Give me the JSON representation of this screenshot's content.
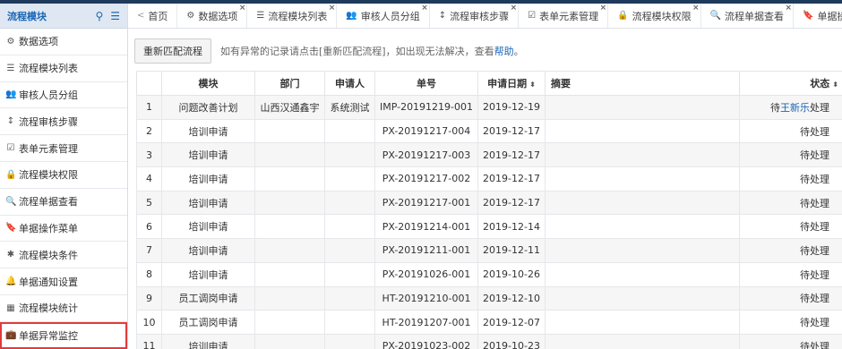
{
  "sidebar": {
    "title": "流程模块",
    "search_icon": "search-icon",
    "menu_icon": "hamburger-icon",
    "items": [
      {
        "label": "数据选项",
        "icon": "gear-icon",
        "glyph": "⚙"
      },
      {
        "label": "流程模块列表",
        "icon": "list-icon",
        "glyph": "☰"
      },
      {
        "label": "审核人员分组",
        "icon": "users-icon",
        "glyph": "👥"
      },
      {
        "label": "流程审核步骤",
        "icon": "sort-icon",
        "glyph": "↕"
      },
      {
        "label": "表单元素管理",
        "icon": "checkbox-icon",
        "glyph": "☑"
      },
      {
        "label": "流程模块权限",
        "icon": "lock-icon",
        "glyph": "🔒"
      },
      {
        "label": "流程单据查看",
        "icon": "search-icon",
        "glyph": "🔍"
      },
      {
        "label": "单据操作菜单",
        "icon": "bookmark-icon",
        "glyph": "🔖"
      },
      {
        "label": "流程模块条件",
        "icon": "asterisk-icon",
        "glyph": "✱"
      },
      {
        "label": "单据通知设置",
        "icon": "bell-icon",
        "glyph": "🔔"
      },
      {
        "label": "流程模块统计",
        "icon": "chart-icon",
        "glyph": "▦"
      },
      {
        "label": "单据异常监控",
        "icon": "briefcase-icon",
        "glyph": "💼"
      }
    ]
  },
  "tabs": [
    {
      "label": "首页",
      "glyph": "<",
      "closable": false
    },
    {
      "label": "数据选项",
      "glyph": "⚙",
      "closable": true
    },
    {
      "label": "流程模块列表",
      "glyph": "☰",
      "closable": true
    },
    {
      "label": "审核人员分组",
      "glyph": "👥",
      "closable": true
    },
    {
      "label": "流程审核步骤",
      "glyph": "↕",
      "closable": true
    },
    {
      "label": "表单元素管理",
      "glyph": "☑",
      "closable": true
    },
    {
      "label": "流程模块权限",
      "glyph": "🔒",
      "closable": true
    },
    {
      "label": "流程单据查看",
      "glyph": "🔍",
      "closable": true
    },
    {
      "label": "单据操作华",
      "glyph": "🔖",
      "closable": true
    }
  ],
  "toolbar": {
    "rematch_label": "重新匹配流程",
    "hint_text": "如有异常的记录请点击[重新匹配流程]，如出现无法解决，查看",
    "help_link": "帮助",
    "hint_suffix": "。"
  },
  "table": {
    "columns": [
      "",
      "模块",
      "部门",
      "申请人",
      "单号",
      "申请日期",
      "摘要",
      "状态"
    ],
    "sort_glyph": "⬍",
    "rows": [
      {
        "n": "1",
        "module": "问题改善计划",
        "dept": "山西汉通鑫宇",
        "applicant": "系统测试",
        "no": "IMP-20191219-001",
        "date": "2019-12-19",
        "summary": "",
        "status_pre": "待",
        "status_link": "王新乐",
        "status_post": "处理"
      },
      {
        "n": "2",
        "module": "培训申请",
        "dept": "",
        "applicant": "",
        "no": "PX-20191217-004",
        "date": "2019-12-17",
        "summary": "",
        "status_pre": "待处理",
        "status_link": "",
        "status_post": ""
      },
      {
        "n": "3",
        "module": "培训申请",
        "dept": "",
        "applicant": "",
        "no": "PX-20191217-003",
        "date": "2019-12-17",
        "summary": "",
        "status_pre": "待处理",
        "status_link": "",
        "status_post": ""
      },
      {
        "n": "4",
        "module": "培训申请",
        "dept": "",
        "applicant": "",
        "no": "PX-20191217-002",
        "date": "2019-12-17",
        "summary": "",
        "status_pre": "待处理",
        "status_link": "",
        "status_post": ""
      },
      {
        "n": "5",
        "module": "培训申请",
        "dept": "",
        "applicant": "",
        "no": "PX-20191217-001",
        "date": "2019-12-17",
        "summary": "",
        "status_pre": "待处理",
        "status_link": "",
        "status_post": ""
      },
      {
        "n": "6",
        "module": "培训申请",
        "dept": "",
        "applicant": "",
        "no": "PX-20191214-001",
        "date": "2019-12-14",
        "summary": "",
        "status_pre": "待处理",
        "status_link": "",
        "status_post": ""
      },
      {
        "n": "7",
        "module": "培训申请",
        "dept": "",
        "applicant": "",
        "no": "PX-20191211-001",
        "date": "2019-12-11",
        "summary": "",
        "status_pre": "待处理",
        "status_link": "",
        "status_post": ""
      },
      {
        "n": "8",
        "module": "培训申请",
        "dept": "",
        "applicant": "",
        "no": "PX-20191026-001",
        "date": "2019-10-26",
        "summary": "",
        "status_pre": "待处理",
        "status_link": "",
        "status_post": ""
      },
      {
        "n": "9",
        "module": "员工调岗申请",
        "dept": "",
        "applicant": "",
        "no": "HT-20191210-001",
        "date": "2019-12-10",
        "summary": "",
        "status_pre": "待处理",
        "status_link": "",
        "status_post": ""
      },
      {
        "n": "10",
        "module": "员工调岗申请",
        "dept": "",
        "applicant": "",
        "no": "HT-20191207-001",
        "date": "2019-12-07",
        "summary": "",
        "status_pre": "待处理",
        "status_link": "",
        "status_post": ""
      },
      {
        "n": "11",
        "module": "培训申请",
        "dept": "",
        "applicant": "",
        "no": "PX-20191023-002",
        "date": "2019-10-23",
        "summary": "",
        "status_pre": "待处理",
        "status_link": "",
        "status_post": ""
      }
    ]
  },
  "colors": {
    "accent": "#1a66b5",
    "highlight_border": "#e23b3b",
    "topbar": "#1f3a5c"
  }
}
